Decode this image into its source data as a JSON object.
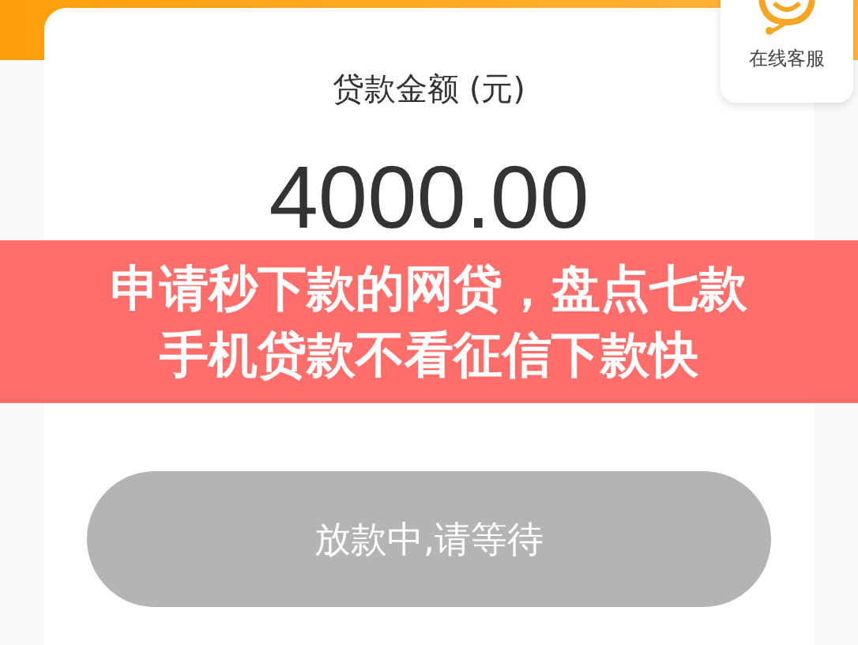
{
  "amount_label": "贷款金额 (元)",
  "amount": "4000.00",
  "customer_service": {
    "label": "在线客服"
  },
  "banner": {
    "lines": [
      "申请秒下款的网贷，盘点七款",
      "手机贷款不看征信下款快"
    ]
  },
  "status_button": {
    "label": "放款中,请等待",
    "disabled": true
  }
}
